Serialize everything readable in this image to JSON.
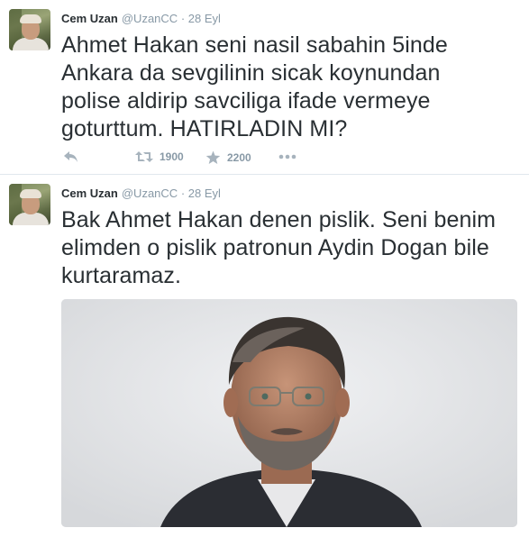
{
  "tweets": [
    {
      "author_name": "Cem Uzan",
      "handle": "@UzanCC",
      "separator": "·",
      "date": "28 Eyl",
      "text": "Ahmet Hakan seni nasil sabahin 5inde\nAnkara da sevgilinin sicak koynundan\npolise aldirip savciliga ifade vermeye\ngoturttum.  HATIRLADIN MI?",
      "retweets": "1900",
      "favorites": "2200",
      "icons": [
        "reply-icon",
        "retweet-icon",
        "favorite-icon",
        "more-icon"
      ]
    },
    {
      "author_name": "Cem Uzan",
      "handle": "@UzanCC",
      "separator": "·",
      "date": "28 Eyl",
      "text": "Bak Ahmet Hakan denen pislik. Seni benim\nelimden o pislik patronun Aydin Dogan bile\nkurtaramaz.",
      "media": "portrait-photo"
    }
  ],
  "colors": {
    "text": "#292f33",
    "muted": "#8899a6",
    "divider": "#e1e8ed",
    "photo_background": "#e4e5e7"
  }
}
